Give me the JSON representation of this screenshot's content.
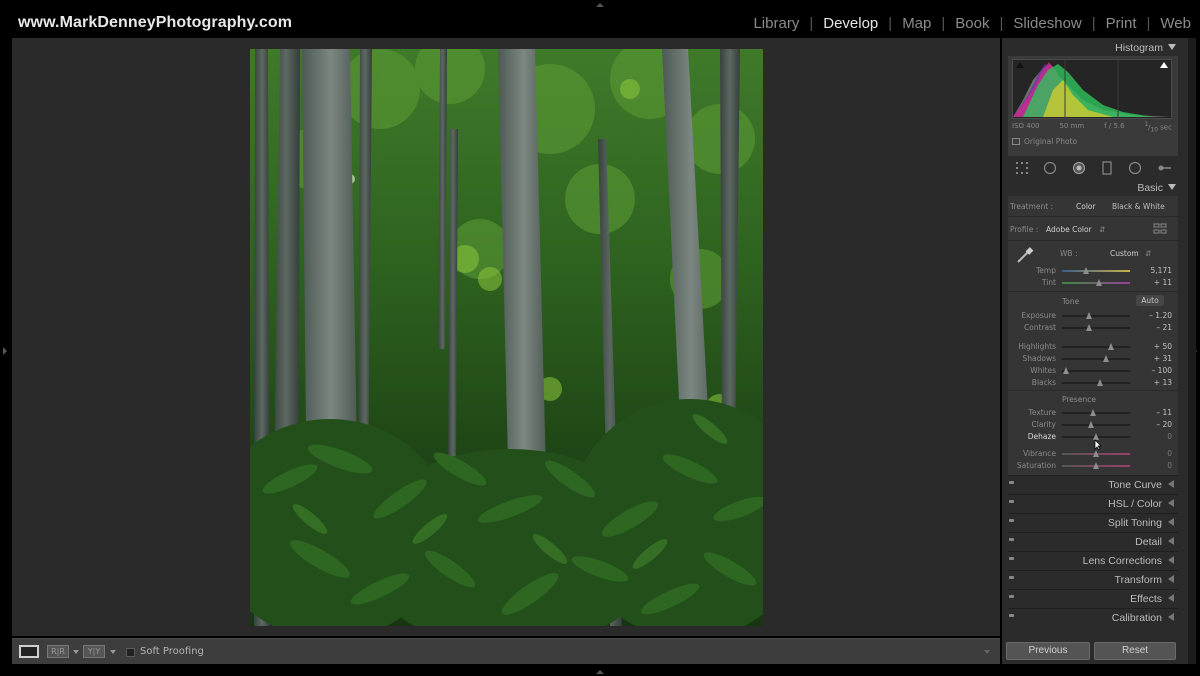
{
  "brand": "www.MarkDenneyPhotography.com",
  "modules": [
    "Library",
    "Develop",
    "Map",
    "Book",
    "Slideshow",
    "Print",
    "Web"
  ],
  "active_module": "Develop",
  "histogram": {
    "title": "Histogram",
    "iso": "ISO 400",
    "focal": "50 mm",
    "aperture": "f / 5.6",
    "shutter_num": "1",
    "shutter_den": "10",
    "shutter_unit": "sec",
    "original_photo": "Original Photo"
  },
  "basic": {
    "title": "Basic",
    "treatment_label": "Treatment :",
    "treatment_color": "Color",
    "treatment_bw": "Black & White",
    "profile_label": "Profile :",
    "profile_value": "Adobe Color",
    "wb_label": "WB :",
    "wb_value": "Custom",
    "tone_label": "Tone",
    "auto_label": "Auto",
    "presence_label": "Presence",
    "sliders": [
      {
        "label": "Temp",
        "value": "5,171",
        "pos": 0.35
      },
      {
        "label": "Tint",
        "value": "+ 11",
        "pos": 0.55
      },
      {
        "label": "Exposure",
        "value": "– 1.20",
        "pos": 0.4
      },
      {
        "label": "Contrast",
        "value": "– 21",
        "pos": 0.4
      },
      {
        "label": "Highlights",
        "value": "+ 50",
        "pos": 0.72
      },
      {
        "label": "Shadows",
        "value": "+ 31",
        "pos": 0.64
      },
      {
        "label": "Whites",
        "value": "– 100",
        "pos": 0.06
      },
      {
        "label": "Blacks",
        "value": "+ 13",
        "pos": 0.56
      },
      {
        "label": "Texture",
        "value": "– 11",
        "pos": 0.45
      },
      {
        "label": "Clarity",
        "value": "– 20",
        "pos": 0.42
      },
      {
        "label": "Dehaze",
        "value": "0",
        "pos": 0.5
      },
      {
        "label": "Vibrance",
        "value": "0",
        "pos": 0.5
      },
      {
        "label": "Saturation",
        "value": "0",
        "pos": 0.5
      }
    ]
  },
  "panels": [
    "Tone Curve",
    "HSL / Color",
    "Split Toning",
    "Detail",
    "Lens Corrections",
    "Transform",
    "Effects",
    "Calibration"
  ],
  "toolbar": {
    "soft_proofing": "Soft Proofing",
    "ba1": "R|R",
    "ba2": "Y|Y"
  },
  "footer": {
    "previous": "Previous",
    "reset": "Reset"
  }
}
